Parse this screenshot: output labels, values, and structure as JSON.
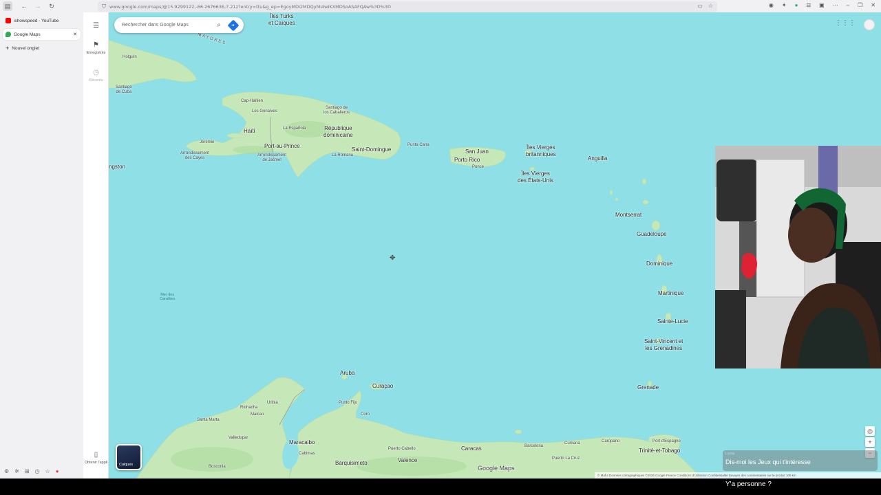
{
  "browser": {
    "url": "www.google.com/maps/@15.9299122,-66.2676636,7.21z?entry=ttu&g_ep=EgoyMDI2MDQyMi4wIKXMDSoASAFQAw%3D%3D",
    "tabs": [
      {
        "label": "ishowspeed - YouTube",
        "favicon_color": "#ff0000"
      },
      {
        "label": "Google Maps",
        "favicon_color": "#34a853"
      }
    ],
    "new_tab_label": "Nouvel onglet"
  },
  "maps": {
    "search_placeholder": "Rechercher dans Google Maps",
    "rail": {
      "saved_label": "Enregistrés",
      "recents_label": "Récents",
      "get_app_label": "Obtenir l'appli"
    },
    "layers_label": "Calques",
    "logo": "Google Maps",
    "attribution": "© Mafui   Données cartographiques ©2026 Google   France   Conditions d'utilisation   Confidentialité   Envoyer des commentaires sur le produit   100 km",
    "labels": {
      "turks": "Îles Turks\net Caïques",
      "mayores": "MAYORES",
      "holguin": "Holguín",
      "santiago_cuba": "Santiago\nde Cuba",
      "cap_haitien": "Cap-Haïtien",
      "gonaives": "Les Gonaives",
      "santiago_cab": "Santiago de\nlos Caballeros",
      "espanola": "La Española",
      "haiti": "Haïti",
      "dominicaine": "République\ndominicaine",
      "jeremie": "Jérémie",
      "port_au_prince": "Port-au-Prince",
      "saint_domingue": "Saint-Domingue",
      "punta_cana": "Punta Cana",
      "arrondissement": "Arrondissement\ndes Cayes",
      "jacmel": "Arrondissement\nde Jacmel",
      "la_romana": "La Romana",
      "kingston": "ngston",
      "san_juan": "San Juan",
      "porto_rico": "Porto Rico",
      "ponce": "Ponce",
      "iv_brit": "Îles Vierges\nbritanniques",
      "iv_us": "Îles Vierges\ndes États-Unis",
      "anguilla": "Anguilla",
      "montserrat": "Montserrat",
      "guadeloupe": "Guadeloupe",
      "dominique": "Dominique",
      "martinique": "Martinique",
      "sainte_lucie": "Sainte-Lucie",
      "saint_vincent": "Saint-Vincent et\nles Grenadines",
      "grenade": "Grenade",
      "mer_caraibes": "Mer des\nCaraïbes",
      "aruba": "Aruba",
      "curacao": "Curaçao",
      "punto_fijo": "Punto Fijo",
      "coro": "Coro",
      "riohacha": "Riohacha",
      "uribia": "Uribia",
      "santa_marta": "Santa Marta",
      "maicao": "Maicao",
      "valledupar": "Valledupar",
      "maracaibo": "Maracaibo",
      "cabimas": "Cabimas",
      "barquisimeto": "Barquisimeto",
      "valencia": "Valence",
      "puerto_cabello": "Puerto Cabello",
      "caracas": "Caracas",
      "barcelona": "Barcelona",
      "cumana": "Cumaná",
      "carupano": "Carúpano",
      "la_cruz": "Puerto La Cruz",
      "trinite": "Trinité-et-Tobago",
      "port_espagne": "Port d'Espagne",
      "bosconia": "Bosconia"
    }
  },
  "chat": {
    "user": "Lucas",
    "message": "Dis-moi les Jeux qui t'intéresse"
  },
  "caption": "Y'a personne ?",
  "colors": {
    "water": "#8fdfe6",
    "land": "#c6e8b8",
    "land_dark": "#a9d89a"
  }
}
